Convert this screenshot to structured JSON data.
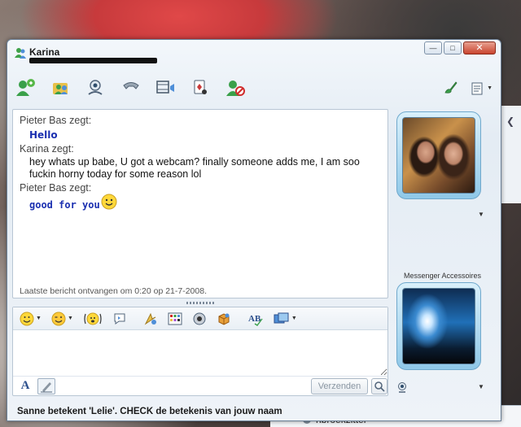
{
  "window": {
    "title": "Karina"
  },
  "toolbar": {
    "buttons": [
      {
        "name": "invite-contact-icon"
      },
      {
        "name": "share-files-icon"
      },
      {
        "name": "video-call-icon"
      },
      {
        "name": "phone-call-icon"
      },
      {
        "name": "webcam-video-icon"
      },
      {
        "name": "games-icon"
      },
      {
        "name": "block-contact-icon"
      }
    ],
    "right": [
      {
        "name": "paint-brush-icon"
      },
      {
        "name": "menu-options-icon"
      }
    ]
  },
  "conversation": {
    "messages": [
      {
        "sender": "Pieter Bas zegt:",
        "text": "Hello"
      },
      {
        "sender": "Karina zegt:",
        "text_line1": "hey whats up babe, U got a webcam? finally someone adds me, I am soo",
        "text_line2": "fuckin horny today for some reason lol"
      },
      {
        "sender": "Pieter Bas zegt:",
        "text": "good for you"
      }
    ],
    "status": "Laatste bericht ontvangen om 0:20 op 21-7-2008."
  },
  "compose": {
    "send_label": "Verzenden",
    "value": ""
  },
  "panel": {
    "accessories_label": "Messenger Accessoires"
  },
  "footer": {
    "text": "Sanne betekent 'Lelie'. CHECK de betekenis van jouw naam"
  },
  "background": {
    "contact_label": "hbroekzitter"
  },
  "colors": {
    "message_blue": "#1a2fb0",
    "window_frame": "#6a7f96",
    "close_red": "#c9452f"
  }
}
